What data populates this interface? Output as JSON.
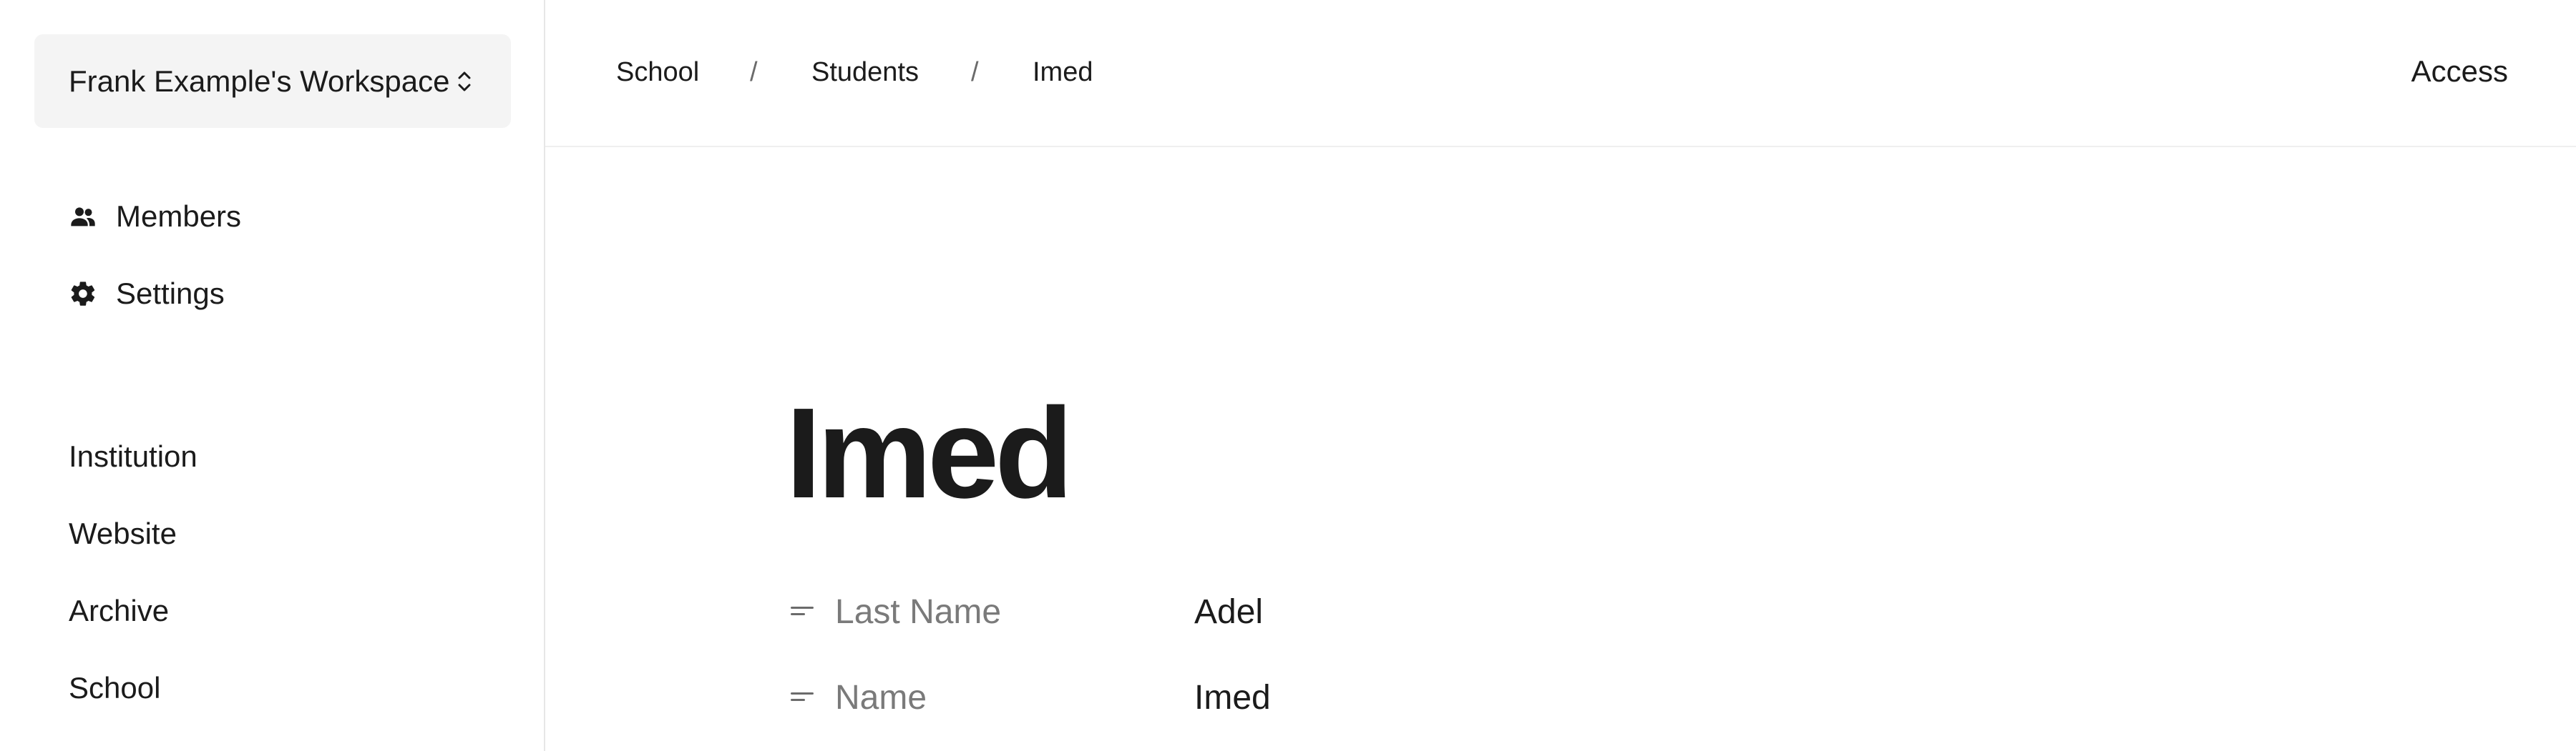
{
  "sidebar": {
    "workspace": {
      "name": "Frank Example's Workspace",
      "icon": "chevron-up-down-icon"
    },
    "nav": [
      {
        "label": "Members",
        "icon": "people-icon"
      },
      {
        "label": "Settings",
        "icon": "gear-icon"
      }
    ],
    "sections": [
      {
        "label": "Institution"
      },
      {
        "label": "Website"
      },
      {
        "label": "Archive"
      },
      {
        "label": "School"
      }
    ]
  },
  "header": {
    "breadcrumb": [
      {
        "label": "School"
      },
      {
        "label": "Students"
      },
      {
        "label": "Imed"
      }
    ],
    "separator": "/",
    "access_label": "Access"
  },
  "main": {
    "title": "Imed",
    "properties": [
      {
        "label": "Last Name",
        "value": "Adel",
        "icon": "text-lines-icon"
      },
      {
        "label": "Name",
        "value": "Imed",
        "icon": "text-lines-icon"
      }
    ]
  }
}
